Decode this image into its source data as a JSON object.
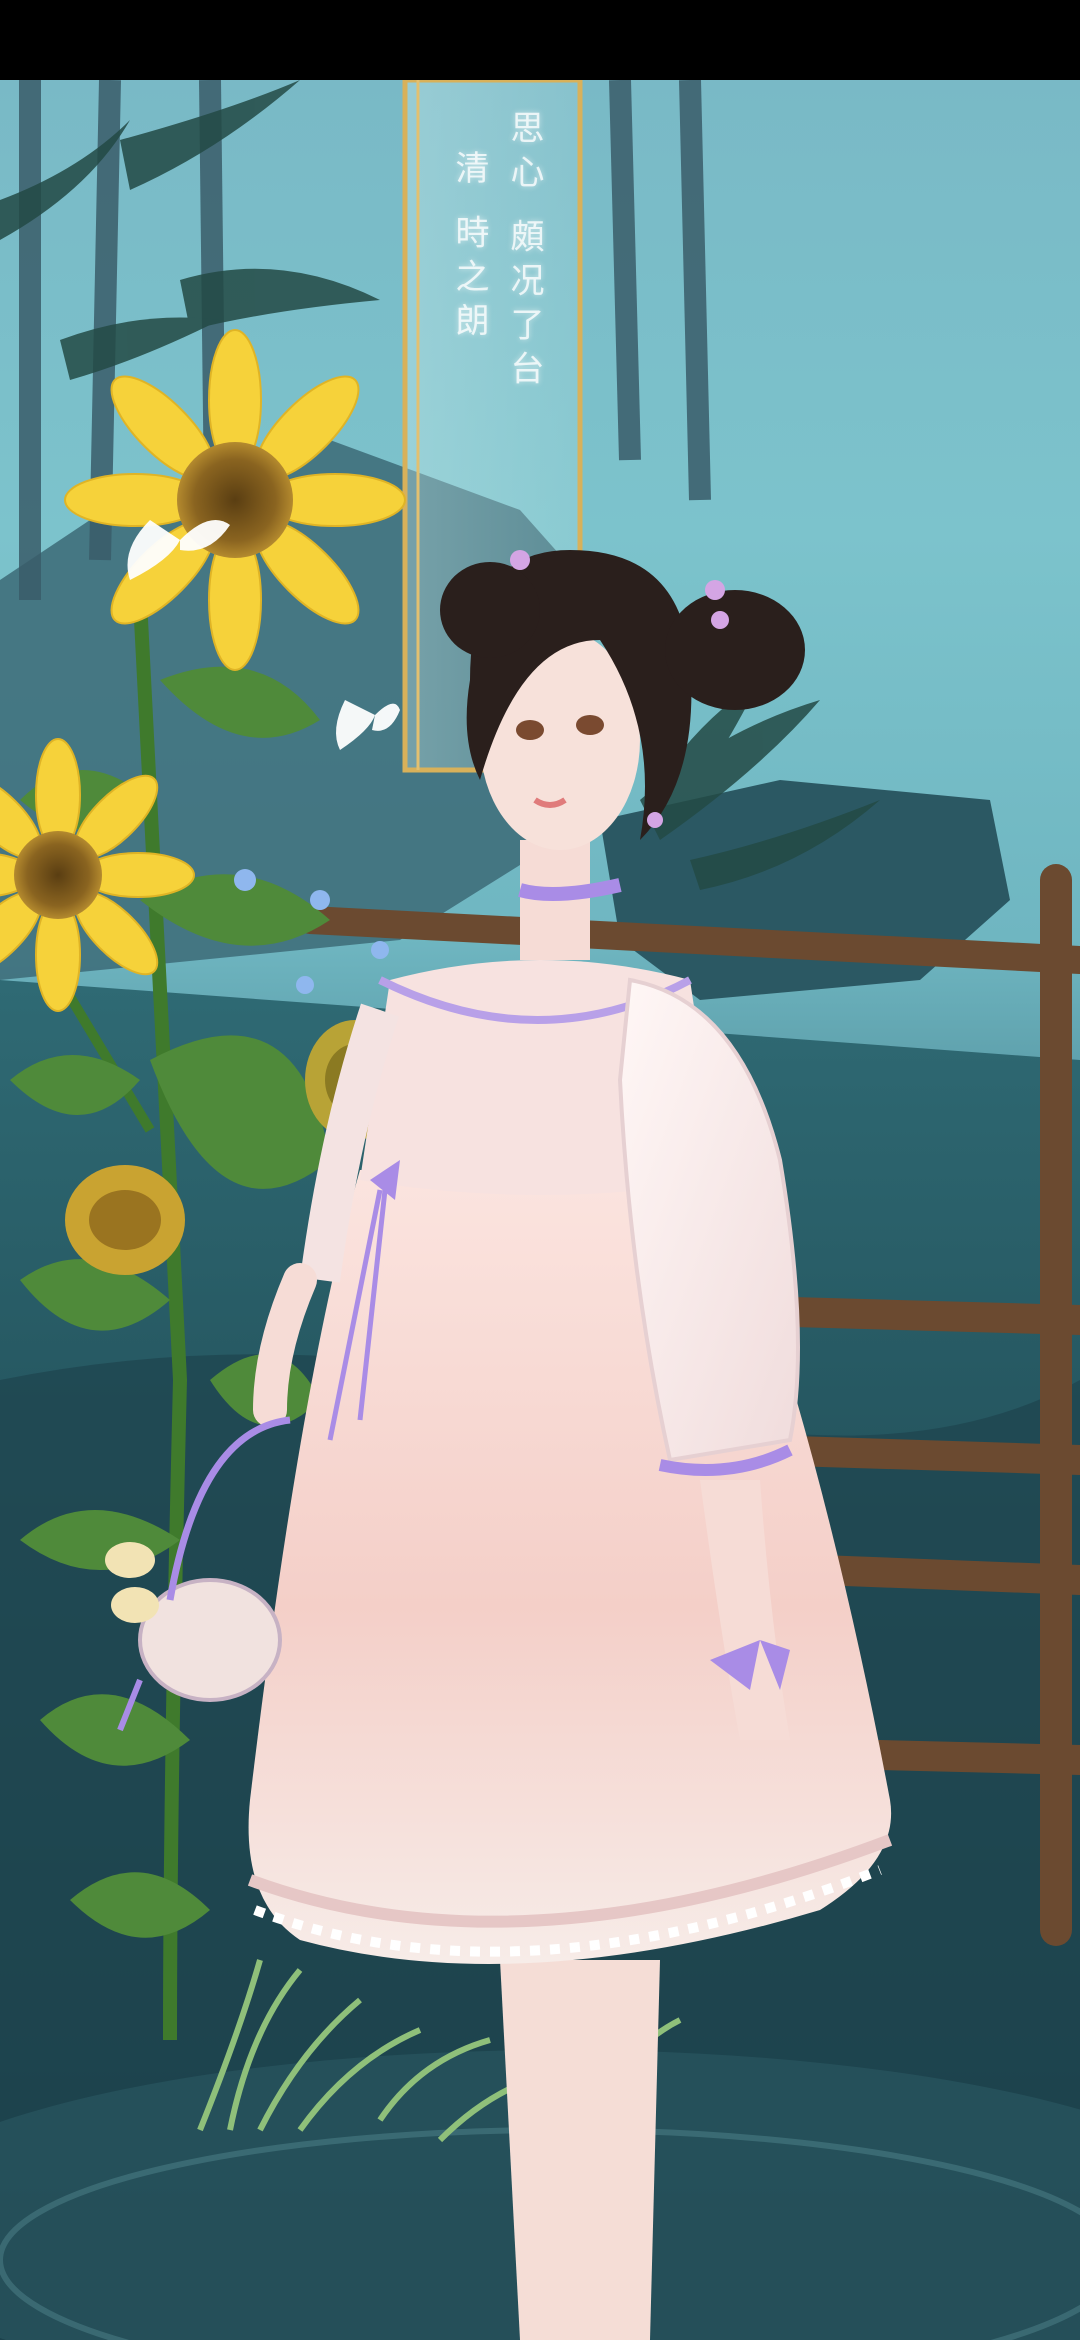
{
  "scene": {
    "description_free": true,
    "banner": {
      "columns": [
        "思心 頗况了台",
        "清 時之朗"
      ]
    },
    "palette": {
      "sky": "#7cc3cc",
      "water": "#2a5e6a",
      "sunflower_petal": "#f6d23a",
      "sunflower_center": "#7a5a1a",
      "leaf": "#4f8a3a",
      "bamboo": "#3a5d6a",
      "dress_pink": "#f6d3cf",
      "dress_white": "#f8f1f2",
      "ribbon_lavender": "#a98ce6",
      "hair": "#2a1f1c",
      "skin": "#f7e1da",
      "fence": "#6b4a30",
      "banner_gold": "#d8b15a"
    }
  }
}
